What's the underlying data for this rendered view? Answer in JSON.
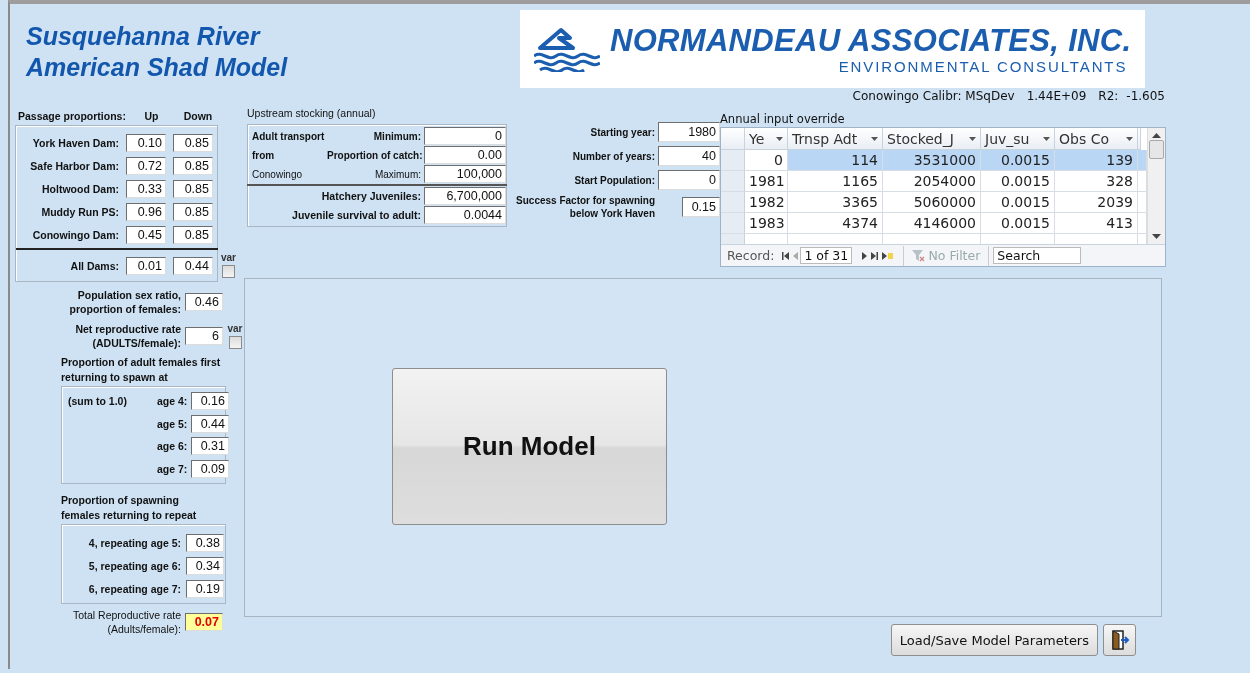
{
  "title_lines": [
    "Susquehanna River",
    "American Shad Model"
  ],
  "logo": {
    "name": "NORMANDEAU ASSOCIATES, INC.",
    "tagline": "ENVIRONMENTAL CONSULTANTS"
  },
  "calibration": {
    "label": "Conowingo Calibr: MSqDev",
    "value": "1.44E+09",
    "r2_label": "R2:",
    "r2_value": "-1.605"
  },
  "passage": {
    "title": "Passage proportions:",
    "up_header": "Up",
    "down_header": "Down",
    "dams": [
      {
        "label": "York Haven Dam:",
        "up": "0.10",
        "down": "0.85"
      },
      {
        "label": "Safe Harbor Dam:",
        "up": "0.72",
        "down": "0.85"
      },
      {
        "label": "Holtwood Dam:",
        "up": "0.33",
        "down": "0.85"
      },
      {
        "label": "Muddy Run PS:",
        "up": "0.96",
        "down": "0.85"
      },
      {
        "label": "Conowingo Dam:",
        "up": "0.45",
        "down": "0.85"
      }
    ],
    "all": {
      "label": "All Dams:",
      "up": "0.01",
      "down": "0.44"
    },
    "var_label": "var",
    "var_checked": false
  },
  "stocking": {
    "title": "Upstream stocking (annual)",
    "transport_lines": [
      "Adult transport",
      "from",
      "Conowingo"
    ],
    "transport_rows": [
      {
        "label": "Minimum:",
        "value": "0"
      },
      {
        "label": "Proportion of catch:",
        "value": "0.00"
      },
      {
        "label": "Maximum:",
        "value": "100,000"
      }
    ],
    "hatchery_rows": [
      {
        "label": "Hatchery Juveniles:",
        "value": "6,700,000"
      },
      {
        "label": "Juvenile survival to adult:",
        "value": "0.0044"
      }
    ]
  },
  "run_settings": [
    {
      "label_lines": [
        "Starting year:"
      ],
      "value": "1980"
    },
    {
      "label_lines": [
        "Number of years:"
      ],
      "value": "40"
    },
    {
      "label_lines": [
        "Start Population:"
      ],
      "value": "0"
    },
    {
      "label_lines": [
        "Success Factor for spawning",
        "below York Haven"
      ],
      "value": "0.15"
    }
  ],
  "override_table": {
    "title": "Annual input override",
    "columns": [
      "Ye",
      "Trnsp Adt",
      "Stocked_J",
      "Juv_su",
      "Obs Co"
    ],
    "rows": [
      {
        "cells": [
          "0",
          "114",
          "3531000",
          "0.0015",
          "139"
        ],
        "selected": true
      },
      {
        "cells": [
          "1981",
          "1165",
          "2054000",
          "0.0015",
          "328"
        ],
        "selected": false
      },
      {
        "cells": [
          "1982",
          "3365",
          "5060000",
          "0.0015",
          "2039"
        ],
        "selected": false
      },
      {
        "cells": [
          "1983",
          "4374",
          "4146000",
          "0.0015",
          "413"
        ],
        "selected": false
      }
    ],
    "navigator": {
      "label": "Record:",
      "position": "1 of 31",
      "filter": "No Filter",
      "search_placeholder": "Search"
    }
  },
  "sex_ratio": {
    "label_lines": [
      "Population sex ratio,",
      "proportion of females:"
    ],
    "value": "0.46"
  },
  "net_rate": {
    "label_lines": [
      "Net reproductive rate",
      "(ADULTS/female):"
    ],
    "value": "6",
    "var_label": "var",
    "var_checked": false
  },
  "first_return": {
    "title_lines": [
      "Proportion of adult females first",
      "returning to spawn at"
    ],
    "note": "(sum to 1.0)",
    "ages": [
      {
        "label": "age 4:",
        "value": "0.16"
      },
      {
        "label": "age 5:",
        "value": "0.44"
      },
      {
        "label": "age 6:",
        "value": "0.31"
      },
      {
        "label": "age 7:",
        "value": "0.09"
      }
    ]
  },
  "repeat": {
    "title_lines": [
      "Proportion of spawning",
      "females  returning to  repeat"
    ],
    "rows": [
      {
        "label": "4, repeating age 5:",
        "value": "0.38"
      },
      {
        "label": "5, repeating age 6:",
        "value": "0.34"
      },
      {
        "label": "6, repeating age 7:",
        "value": "0.19"
      }
    ]
  },
  "total_rate": {
    "label_lines": [
      "Total Reproductive rate",
      "(Adults/female):"
    ],
    "value": "0.07",
    "highlighted": true
  },
  "buttons": {
    "run": "Run Model",
    "load_save": "Load/Save Model Parameters"
  }
}
